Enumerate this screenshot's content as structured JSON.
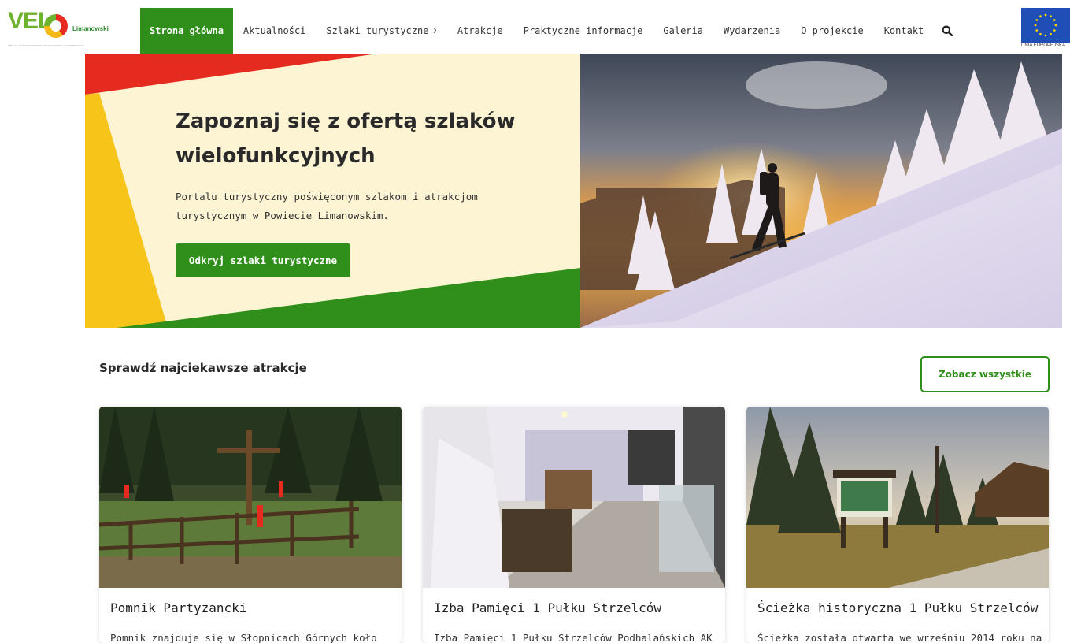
{
  "header": {
    "logo": {
      "main": "VEL",
      "name": "Limanowski",
      "tagline": "SIEĆ SZLAKÓW WIELOFUNKCYJNYCH POWIATU LIMANOWSKIEGO"
    },
    "nav": [
      {
        "label": "Strona główna",
        "active": true
      },
      {
        "label": "Aktualności"
      },
      {
        "label": "Szlaki turystyczne",
        "dropdown": true
      },
      {
        "label": "Atrakcje"
      },
      {
        "label": "Praktyczne informacje"
      },
      {
        "label": "Galeria"
      },
      {
        "label": "Wydarzenia"
      },
      {
        "label": "O projekcie"
      },
      {
        "label": "Kontakt"
      }
    ],
    "search_icon": "search-icon",
    "eu_label": "UNIA EUROPEJSKA"
  },
  "hero": {
    "title": "Zapoznaj się z ofertą szlaków wielofunkcyjnych",
    "text": "Portalu turystyczny poświęconym szlakom i atrakcjom turystycznym w Powiecie Limanowskim.",
    "button": "Odkryj szlaki turystyczne"
  },
  "attractions": {
    "title": "Sprawdź najciekawsze atrakcje",
    "see_all": "Zobacz wszystkie",
    "cards": [
      {
        "title": "Pomnik Partyzancki",
        "desc": "Pomnik znajduje się w Słopnicach Górnych koło"
      },
      {
        "title": "Izba Pamięci 1 Pułku Strzelców",
        "desc": "Izba Pamięci 1 Pułku Strzelców Podhalańskich AK"
      },
      {
        "title": "Ścieżka historyczna 1 Pułku Strzelców",
        "desc": "Ścieżka została otwarta we wrześniu 2014 roku na"
      }
    ]
  },
  "colors": {
    "brand_green": "#2f8f1a",
    "red": "#e52b1f",
    "yellow": "#f7c51a",
    "cream": "#fdf4d4",
    "eu_blue": "#1f4fb6"
  }
}
